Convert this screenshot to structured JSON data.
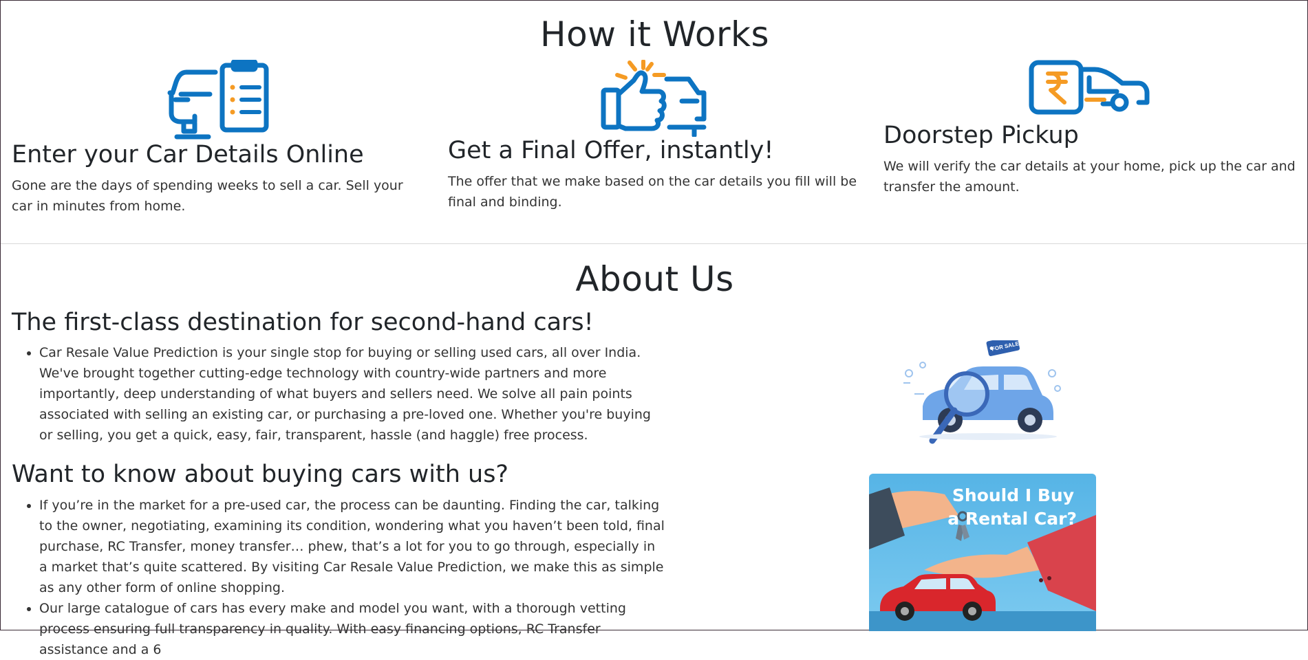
{
  "how_it_works": {
    "heading": "How it Works",
    "steps": [
      {
        "icon": "car-checklist-icon",
        "title": "Enter your Car Details Online",
        "text": "Gone are the days of spending weeks to sell a car. Sell your car in minutes from home."
      },
      {
        "icon": "thumbs-up-car-icon",
        "title": "Get a Final Offer, instantly!",
        "text": "The offer that we make based on the car details you fill will be final and binding."
      },
      {
        "icon": "rupee-car-icon",
        "title": "Doorstep Pickup",
        "text": "We will verify the car details at your home, pick up the car and transfer the amount."
      }
    ]
  },
  "about": {
    "heading": "About Us",
    "destination": {
      "title": "The first-class destination for second-hand cars!",
      "items": [
        "Car Resale Value Prediction is your single stop for buying or selling used cars, all over India. We've brought together cutting-edge technology with country-wide partners and more importantly, deep understanding of what buyers and sellers need. We solve all pain points associated with selling an existing car, or purchasing a pre-loved one. Whether you're buying or selling, you get a quick, easy, fair, transparent, hassle (and haggle) free process."
      ]
    },
    "buying": {
      "title": "Want to know about buying cars with us?",
      "items": [
        "If you’re in the market for a pre-used car, the process can be daunting. Finding the car, talking to the owner, negotiating, examining its condition, wondering what you haven’t been told, final purchase, RC Transfer, money transfer… phew, that’s a lot for you to go through, especially in a market that’s quite scattered. By visiting Car Resale Value Prediction, we make this as simple as any other form of online shopping.",
        "Our large catalogue of cars has every make and model you want, with a thorough vetting process ensuring full transparency in quality. With easy financing options, RC Transfer assistance and a 6"
      ]
    },
    "images": {
      "for_sale_tag": "FOR SALE",
      "rental_line1": "Should I Buy",
      "rental_line2": "a Rental Car?"
    }
  },
  "colors": {
    "icon_blue": "#0d74c2",
    "icon_orange": "#f59b24",
    "car_blue": "#6ea5e8",
    "rental_bg": "#5cb8e6",
    "rental_red": "#d9434c",
    "text": "#212529"
  }
}
